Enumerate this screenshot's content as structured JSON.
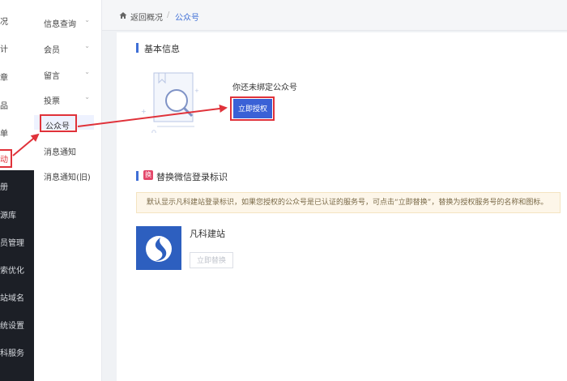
{
  "primary_sidebar": {
    "items": [
      {
        "label": "况"
      },
      {
        "label": "计"
      },
      {
        "label": "章"
      },
      {
        "label": "品"
      },
      {
        "label": "单"
      },
      {
        "label": "动"
      },
      {
        "label": "册"
      },
      {
        "label": "源库"
      },
      {
        "label": "员管理"
      },
      {
        "label": "索优化"
      },
      {
        "label": "站域名"
      },
      {
        "label": "统设置"
      },
      {
        "label": "科服务"
      }
    ]
  },
  "secondary_sidebar": {
    "items": [
      {
        "label": "信息查询",
        "chevron": "⌄"
      },
      {
        "label": "会员",
        "chevron": "⌄"
      },
      {
        "label": "留言",
        "chevron": "⌄"
      },
      {
        "label": "投票",
        "chevron": "⌄"
      },
      {
        "label": "公众号"
      },
      {
        "label": "消息通知"
      },
      {
        "label": "消息通知(旧)"
      }
    ]
  },
  "breadcrumb": {
    "back": "返回概况",
    "separator": "/",
    "current": "公众号"
  },
  "basic_info": {
    "title": "基本信息",
    "unbound_text": "你还未绑定公众号",
    "authorize_button": "立即授权"
  },
  "replace_section": {
    "badge": "换",
    "title": "替换微信登录标识",
    "notice": "默认显示凡科建站登录标识，如果您授权的公众号是已认证的服务号，可点击“立即替换”，替换为授权服务号的名称和图标。",
    "site_name": "凡科建站",
    "replace_button": "立即替换"
  },
  "colors": {
    "accent": "#3a61d6",
    "annotation_red": "#e0323a",
    "logo_blue": "#2d5fbf"
  }
}
